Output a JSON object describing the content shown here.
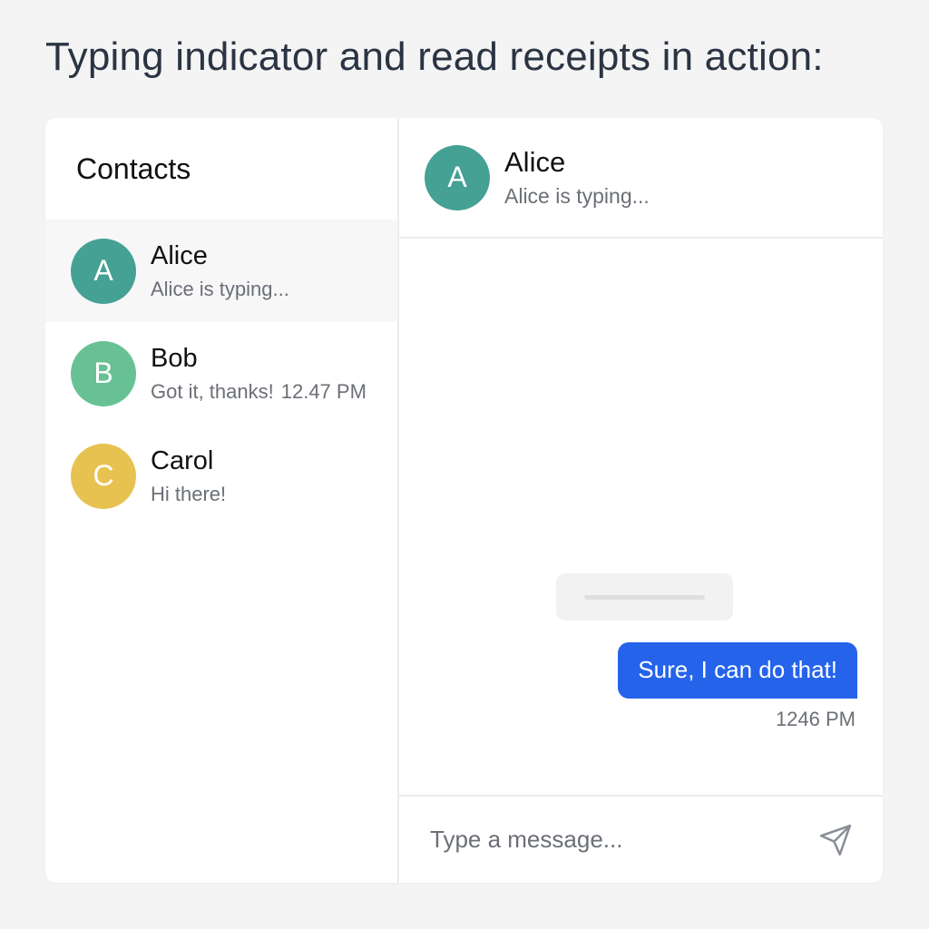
{
  "heading": "Typing indicator and read receipts in action:",
  "sidebar": {
    "title": "Contacts",
    "contacts": [
      {
        "initial": "A",
        "name": "Alice",
        "preview": "Alice is typing...",
        "time": "",
        "color": "#44a194",
        "active": true
      },
      {
        "initial": "B",
        "name": "Bob",
        "preview": "Got it, thanks!",
        "time": "12.47 PM",
        "color": "#68c194",
        "active": false
      },
      {
        "initial": "C",
        "name": "Carol",
        "preview": "Hi there!",
        "time": "",
        "color": "#e8c251",
        "active": false
      }
    ]
  },
  "chat": {
    "header": {
      "initial": "A",
      "name": "Alice",
      "status": "Alice is typing...",
      "color": "#44a194"
    },
    "messages": [
      {
        "text": "Sure, I can do that!",
        "time": "1246 PM",
        "from": "me"
      }
    ],
    "composer": {
      "placeholder": "Type a message...",
      "send_icon": "send-icon"
    }
  },
  "colors": {
    "accent": "#2563eb",
    "background": "#f4f4f5"
  }
}
